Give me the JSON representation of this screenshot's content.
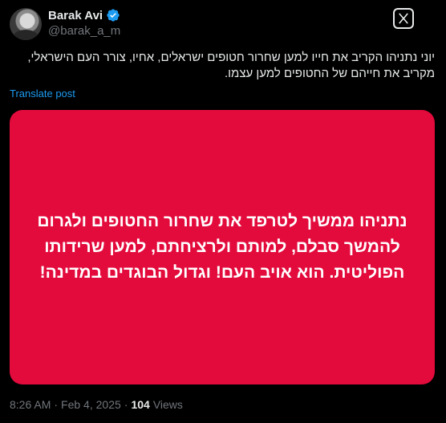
{
  "author": {
    "display_name": "Barak Avi",
    "handle": "@barak_a_m",
    "verified": true,
    "verified_color": "#1d9bf0",
    "avatar_icon": "profile-photo"
  },
  "header": {
    "grok_icon": "grok-icon"
  },
  "post": {
    "text": "יוני נתניהו הקריב את חייו למען שחרור חטופים ישראלים, אחיו, צורר העם הישראלי, מקריב את חייהם של החטופים למען עצמו.",
    "translate_label": "Translate post"
  },
  "media": {
    "background_color": "#e30a3c",
    "text": "נתניהו ממשיך לטרפד את שחרור החטופים ולגרום להמשך סבלם, למותם ולרציחתם, למען שרידותו הפוליטית. הוא אויב העם! וגדול הבוגדים במדינה!"
  },
  "meta": {
    "time": "8:26 AM",
    "separator1": "·",
    "date": "Feb 4, 2025",
    "separator2": "·",
    "views_count": "104",
    "views_label": "Views"
  }
}
